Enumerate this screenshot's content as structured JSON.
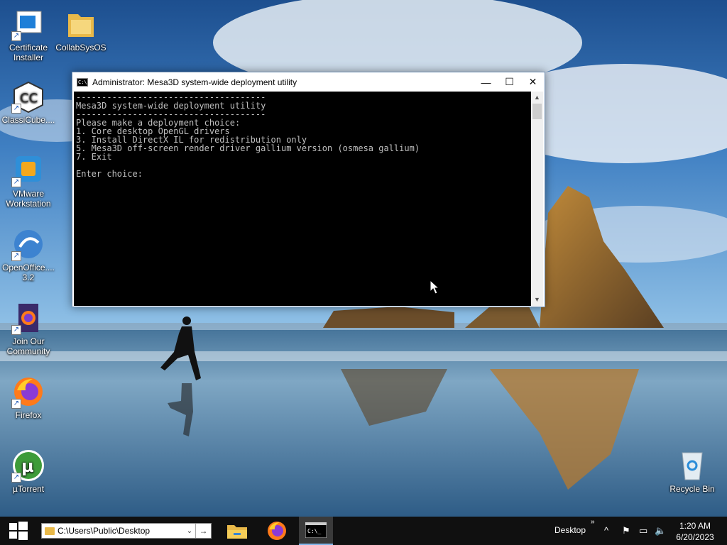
{
  "desktop": {
    "icons": [
      {
        "label": "Certificate Installer",
        "icon": "certificate-installer-icon"
      },
      {
        "label": "CollabSysOS",
        "icon": "folder-icon"
      },
      {
        "label": "ClassiCube....",
        "icon": "classicube-icon"
      },
      {
        "label": "VMware Workstation",
        "icon": "vmware-icon"
      },
      {
        "label": "OpenOffice.... 3.2",
        "icon": "openoffice-icon"
      },
      {
        "label": "Join Our Community",
        "icon": "firefox-document-icon"
      },
      {
        "label": "Firefox",
        "icon": "firefox-icon"
      },
      {
        "label": "µTorrent",
        "icon": "utorrent-icon"
      },
      {
        "label": "Recycle Bin",
        "icon": "recycle-bin-icon"
      }
    ]
  },
  "window": {
    "title": "Administrator:  Mesa3D system-wide deployment utility",
    "console_lines": [
      "-------------------------------------",
      "Mesa3D system-wide deployment utility",
      "-------------------------------------",
      "Please make a deployment choice:",
      "1. Core desktop OpenGL drivers",
      "3. Install DirectX IL for redistribution only",
      "5. Mesa3D off-screen render driver gallium version (osmesa gallium)",
      "7. Exit",
      "",
      "Enter choice:"
    ],
    "minimize": "—",
    "maximize": "☐",
    "close": "✕"
  },
  "taskbar": {
    "address_path": "C:\\Users\\Public\\Desktop",
    "desktop_label": "Desktop",
    "tray_chevron": "»",
    "time": "1:20 AM",
    "date": "6/20/2023"
  },
  "colors": {
    "taskbar": "#101010",
    "console_bg": "#000000",
    "console_fg": "#c0c0c0",
    "accent": "#7fb4e8"
  }
}
